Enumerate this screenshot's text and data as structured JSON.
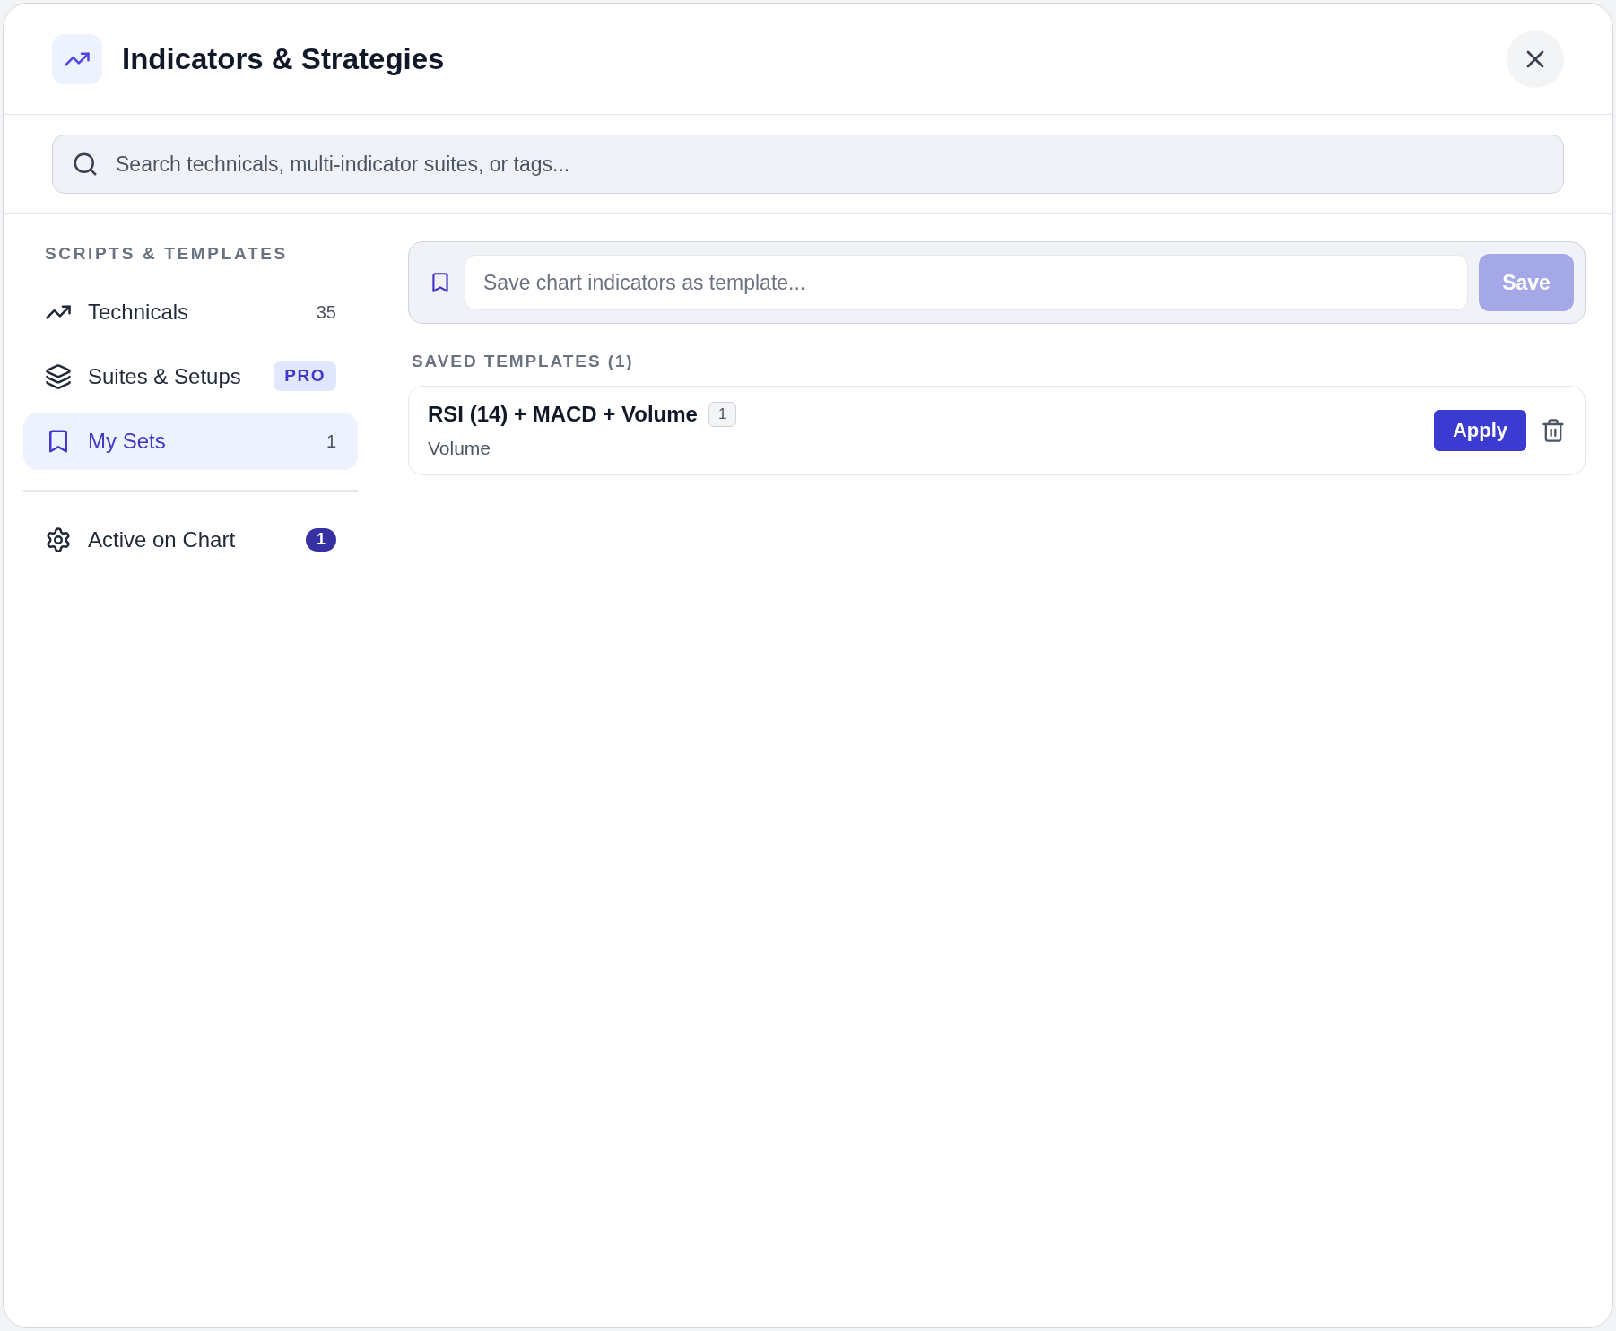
{
  "dialog": {
    "title": "Indicators & Strategies"
  },
  "search": {
    "placeholder": "Search technicals, multi-indicator suites, or tags..."
  },
  "sidebar": {
    "heading": "SCRIPTS & TEMPLATES",
    "items": [
      {
        "kind": "technicals",
        "label": "Technicals",
        "count": "35",
        "selected": false
      },
      {
        "kind": "suites",
        "label": "Suites & Setups",
        "badge": "PRO",
        "selected": false
      },
      {
        "kind": "sets",
        "label": "My Sets",
        "count": "1",
        "selected": true
      }
    ],
    "active": {
      "label": "Active on Chart",
      "count": "1"
    }
  },
  "save_bar": {
    "placeholder": "Save chart indicators as template...",
    "button": "Save",
    "disabled": true
  },
  "saved_templates": {
    "heading": "SAVED TEMPLATES (1)",
    "items": [
      {
        "name": "RSI (14) + MACD + Volume",
        "count": "1",
        "subtitle": "Volume",
        "button": "Apply"
      }
    ]
  }
}
